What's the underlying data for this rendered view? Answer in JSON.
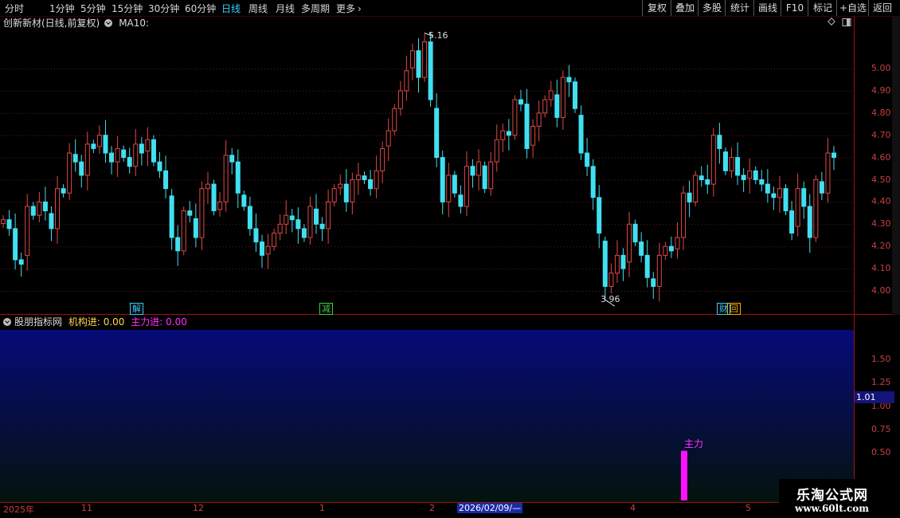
{
  "toolbar": {
    "periods": [
      "分时",
      "1分钟",
      "5分钟",
      "15分钟",
      "30分钟",
      "60分钟",
      "日线",
      "周线",
      "月线",
      "多周期",
      "更多"
    ],
    "active_period": "日线",
    "more_chevron": "›",
    "right_buttons": [
      "复权",
      "叠加",
      "多股",
      "统计",
      "画线",
      "F10",
      "标记",
      "+自选",
      "返回"
    ]
  },
  "price_pane": {
    "title": "创新新材(日线,前复权)",
    "ma_label": "MA10:",
    "y_ticks": [
      "5.00",
      "4.90",
      "4.80",
      "4.70",
      "4.60",
      "4.50",
      "4.40",
      "4.30",
      "4.20",
      "4.10",
      "4.00"
    ],
    "high_marker": "5.16",
    "low_marker": "3.96",
    "events": [
      {
        "text": "解",
        "color": "#3ad0ff"
      },
      {
        "text": "减",
        "color": "#40d040"
      },
      {
        "text": "财",
        "color": "#3ad0ff"
      },
      {
        "text": "回",
        "color": "#ffb000"
      }
    ],
    "colors": {
      "up": "#e04848",
      "down": "#40e0f0",
      "grid": "#6a1a1a"
    }
  },
  "indicator_pane": {
    "name": "股朋指标网",
    "label1": "机构进:",
    "value1": "0.00",
    "label2": "主力进:",
    "value2": "0.00",
    "y_ticks": [
      "1.50",
      "1.25",
      "1.00",
      "0.75",
      "0.50"
    ],
    "current_value": "1.01",
    "bar_label": "主力",
    "bar_value": 0.52,
    "colors": {
      "bar": "#ff10ff",
      "bg_top": "#060a78",
      "bg_bottom": "#05130d"
    }
  },
  "date_axis": {
    "labels": [
      "2025年",
      "11",
      "12",
      "1",
      "2",
      "2026/02/09/—",
      "4",
      "5"
    ]
  },
  "watermark": {
    "line1": "乐淘公式网",
    "line2": "www.60lt.com"
  },
  "chart_data": {
    "type": "candlestick",
    "title": "创新新材(日线,前复权)",
    "ylim": [
      3.93,
      5.22
    ],
    "y_ticks": [
      4.0,
      4.1,
      4.2,
      4.3,
      4.4,
      4.5,
      4.6,
      4.7,
      4.8,
      4.9,
      5.0
    ],
    "high": 5.16,
    "low": 3.96,
    "close": [
      4.32,
      4.28,
      4.14,
      4.12,
      4.38,
      4.34,
      4.4,
      4.36,
      4.28,
      4.46,
      4.44,
      4.62,
      4.58,
      4.52,
      4.66,
      4.64,
      4.7,
      4.62,
      4.58,
      4.64,
      4.6,
      4.56,
      4.66,
      4.62,
      4.68,
      4.58,
      4.54,
      4.46,
      4.24,
      4.18,
      4.36,
      4.34,
      4.24,
      4.46,
      4.48,
      4.36,
      4.4,
      4.61,
      4.58,
      4.44,
      4.38,
      4.28,
      4.22,
      4.16,
      4.2,
      4.26,
      4.3,
      4.34,
      4.32,
      4.28,
      4.24,
      4.38,
      4.3,
      4.28,
      4.4,
      4.46,
      4.48,
      4.4,
      4.5,
      4.52,
      4.5,
      4.46,
      4.54,
      4.64,
      4.72,
      4.82,
      4.9,
      4.99,
      5.08,
      4.96,
      5.12,
      4.86,
      4.6,
      4.4,
      4.52,
      4.44,
      4.38,
      4.56,
      4.52,
      4.58,
      4.46,
      4.58,
      4.68,
      4.72,
      4.7,
      4.86,
      4.84,
      4.64,
      4.74,
      4.8,
      4.86,
      4.9,
      4.78,
      4.96,
      4.94,
      4.82,
      4.62,
      4.56,
      4.42,
      4.26,
      4.02,
      4.08,
      4.16,
      4.1,
      4.3,
      4.22,
      4.16,
      4.06,
      4.02,
      4.16,
      4.2,
      4.18,
      4.24,
      4.44,
      4.4,
      4.52,
      4.5,
      4.48,
      4.7,
      4.64,
      4.54,
      4.6,
      4.52,
      4.5,
      4.54,
      4.5,
      4.48,
      4.44,
      4.42,
      4.46,
      4.36,
      4.26,
      4.46,
      4.38,
      4.24,
      4.5,
      4.44,
      4.62,
      4.6
    ]
  }
}
